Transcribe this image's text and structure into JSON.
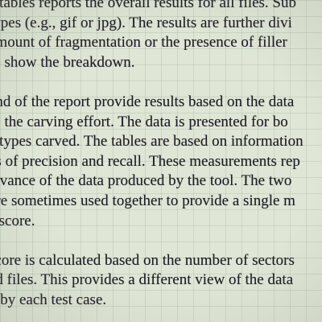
{
  "document": {
    "paragraphs": [
      {
        "lines": [
          "e tables reports the overall results for all files.  Sub",
          "types (e.g., gif or jpg).  The results are further divi",
          "amount of fragmentation or the presence of filler",
          "to show the breakdown."
        ]
      },
      {
        "lines": [
          "end of the report provide results based on the data",
          "to the carving effort.  The data is presented for bo",
          "e types carved. The tables are based on information",
          "es of precision and recall. These measurements rep",
          "levance of the data produced by the tool.  The two",
          "are sometimes used together to provide a single m",
          "f-score."
        ]
      },
      {
        "lines": [
          "score is calculated based on the number of sectors",
          "ed files. This provides a different view of the data",
          "d by each test case."
        ]
      }
    ]
  }
}
